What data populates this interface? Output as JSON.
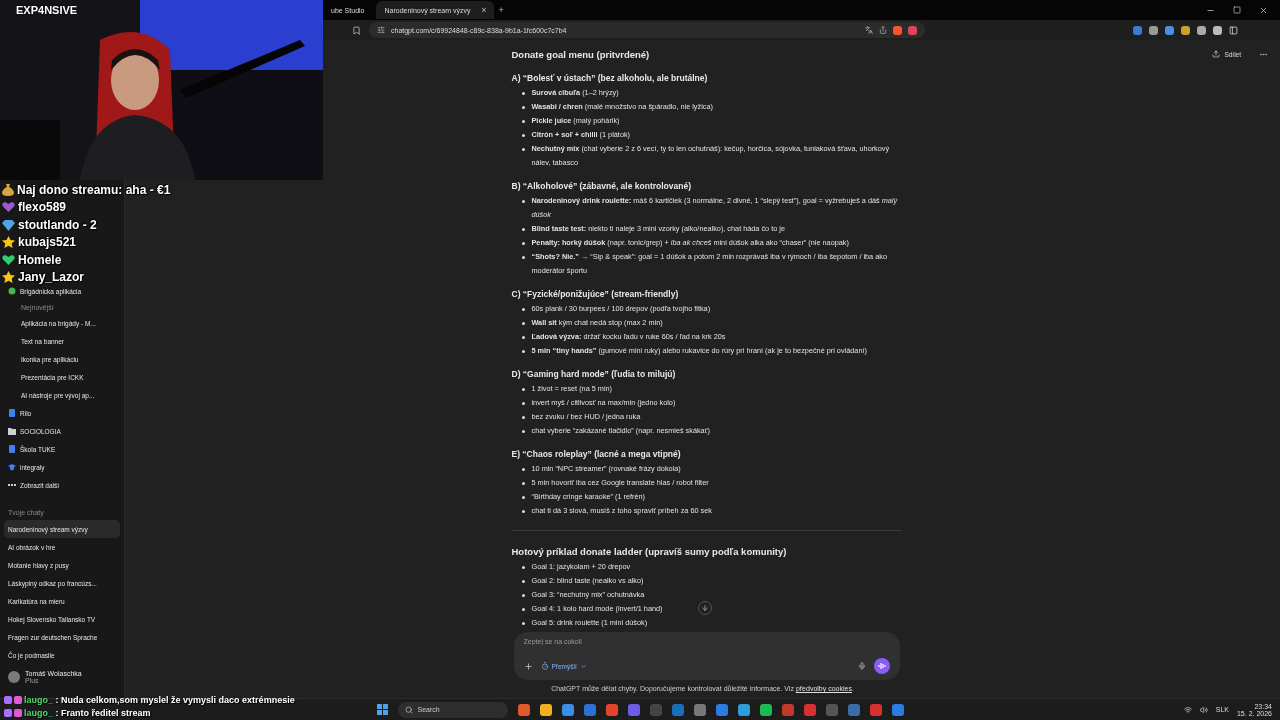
{
  "stream": {
    "channel": "EXP4NSIVE",
    "alerts": [
      {
        "kind": "bag",
        "color": "#d9a441",
        "text": "Naj dono streamu: aha - €1"
      },
      {
        "kind": "heart",
        "color": "#9b59d6",
        "text": "flexo589"
      },
      {
        "kind": "gem",
        "color": "#4aa8e8",
        "text": "stoutlando - 2"
      },
      {
        "kind": "star",
        "color": "#f5c518",
        "text": "kubajs521"
      },
      {
        "kind": "heart",
        "color": "#2ecc71",
        "text": "Homele"
      },
      {
        "kind": "star",
        "color": "#f5c518",
        "text": "Jany_Lazor"
      }
    ],
    "chat": [
      {
        "user": "laugo_",
        "message": ": Nuda celkom,som myslel že vymysli daco extrémnesie"
      },
      {
        "user": "laugo_",
        "message": ": Franto ředitel stream"
      }
    ]
  },
  "browser": {
    "tabs": [
      {
        "label": "ube Studio",
        "selected": false
      },
      {
        "label": "Narodeninový stream výzvy",
        "selected": true,
        "close": "×"
      }
    ],
    "new_tab": "+",
    "url": "chatgpt.com/c/69924848-c89c-838a-9b1a-1fc600c7c7b4"
  },
  "sidebar": {
    "projects": [
      {
        "label": "Brigádnicka aplikácia",
        "kind": "circle",
        "color": "#3fb950",
        "children_heading": "Nejnovější",
        "children": [
          {
            "label": "Aplikácia na brigády - M..."
          },
          {
            "label": "Text na banner"
          },
          {
            "label": "Ikonka pre aplikáciu"
          },
          {
            "label": "Prezentácia pre ICKK"
          },
          {
            "label": "AI nástroje pre vývoj ap..."
          }
        ]
      },
      {
        "label": "Rilo",
        "kind": "tablet",
        "color": "#3b82f6"
      },
      {
        "label": "SOCIOLOGIA",
        "kind": "folder",
        "color": "#d0d0d0"
      },
      {
        "label": "Škola TUKE",
        "kind": "tablet",
        "color": "#3b82f6"
      },
      {
        "label": "integraly",
        "kind": "cap",
        "color": "#3b82f6"
      },
      {
        "label": "Zobrazit další",
        "kind": "dots",
        "color": "#d0d0d0"
      }
    ],
    "chats_heading": "Tvoje chaty",
    "chats": [
      {
        "label": "Narodeninový stream výzvy",
        "selected": true
      },
      {
        "label": "AI obrázok v hre",
        "selected": false
      },
      {
        "label": "Motanie hlavy z pusy",
        "selected": false
      },
      {
        "label": "Láskyplný odkaz po francúzs...",
        "selected": false
      },
      {
        "label": "Karikatúra na mieru",
        "selected": false
      },
      {
        "label": "Hokej Slovensko Taliansko TV",
        "selected": false
      },
      {
        "label": "Fragen zur deutschen Sprache",
        "selected": false
      },
      {
        "label": "Čo je podmaslie",
        "selected": false
      }
    ],
    "user": {
      "name": "Tomáš Wolaschka",
      "plan": "Plus"
    }
  },
  "header": {
    "share": "Sdílet"
  },
  "content": {
    "title": "Donate goal menu (pritvrdené)",
    "sections": [
      {
        "heading": "A) “Bolesť v ústach” (bez alkoholu, ale brutálne)",
        "items": [
          "**Surová cibuľa** (1–2 hrýzy)",
          "**Wasabi / chren** (malé množstvo na špáradlo, nie lyžica)",
          "**Pickle juice** (malý pohárik)",
          "**Citrón + soľ + chilli** (1 plátok)",
          "**Nechutný mix** (chat vyberie 2 z 6 vecí, ty to len ochutnáš): kečup, horčica, sójovka, tuniaková šťava, uhorkový nálev, tabasco"
        ]
      },
      {
        "heading": "B) “Alkoholové” (zábavné, ale kontrolované)",
        "items": [
          "**Narodeninový drink roulette:** máš 6 kartičiek (3 normálne, 2 divné, 1 “slepý test”), goal = vyžrebuješ a dáš *malý dúšok*",
          "**Blind taste test:** niekto ti naleje 3 mini vzorky (alko/nealko), chat háda čo to je",
          "**Penalty: horký dúšok** (napr. tonic/grep) + *iba ak chceš* mini dúšok alka ako “chaser” (nie naopak)",
          "**“Shots? Nie.”** → “Sip & speak”: goal = 1 dúšok a potom 2 min rozprávaš iba v rýmoch / iba šepotom / iba ako moderátor športu"
        ]
      },
      {
        "heading": "C) “Fyzické/ponižujúce” (stream-friendly)",
        "items": [
          "60s plank / 30 burpees / 100 drepov (podľa tvojho fitka)",
          "**Wall sit** kým chat nedá stop (max 2 min)",
          "**Ľadová výzva:** držať kocku ľadu v ruke 60s / ľad na krk 20s",
          "**5 min “tiny hands”** (gumové mini ruky) alebo rukavice do rúry pri hraní (ak je to bezpečné pri ovládaní)"
        ]
      },
      {
        "heading": "D) “Gaming hard mode” (ľudia to milujú)",
        "items": [
          "1 život = reset (na 5 min)",
          "invert myš / citlivosť na max/min (jedno kolo)",
          "bez zvuku / bez HUD / jedna ruka",
          "chat vyberie “zakázané tlačidlo” (napr. nesmieš skákať)"
        ]
      },
      {
        "heading": "E) “Chaos roleplay” (lacné a mega vtipné)",
        "items": [
          "10 min “NPC streamer” (rovnaké frázy dokola)",
          "5 min hovoriť iba cez Google translate hlas / robot filter",
          "“Birthday cringe karaoke” (1 refrén)",
          "chat ti dá 3 slová, musíš z toho spraviť príbeh za 60 sek"
        ]
      }
    ],
    "ladder": {
      "heading": "Hotový príklad donate ladder (upravíš sumy podľa komunity)",
      "items": [
        "Goal 1: jazykolam + 20 drepov",
        "Goal 2: blind taste (nealko vs alko)",
        "Goal 3: “nechutný mix” ochutnávka",
        "Goal 4: 1 kolo hard mode (invert/1 hand)",
        "Goal 5: drink roulette (1 mini dúšok)"
      ]
    }
  },
  "composer": {
    "placeholder": "Zeptej se na cokoli",
    "mode": "Přemýšlí"
  },
  "footer": {
    "text": "ChatGPT může dělat chyby. Doporučujeme kontrolovat důležité informace. Viz ",
    "link": "předvolby cookies",
    "end": "."
  },
  "taskbar": {
    "search": "Search",
    "language": "SLK",
    "time": "23:34",
    "date": "15. 2. 2026"
  }
}
